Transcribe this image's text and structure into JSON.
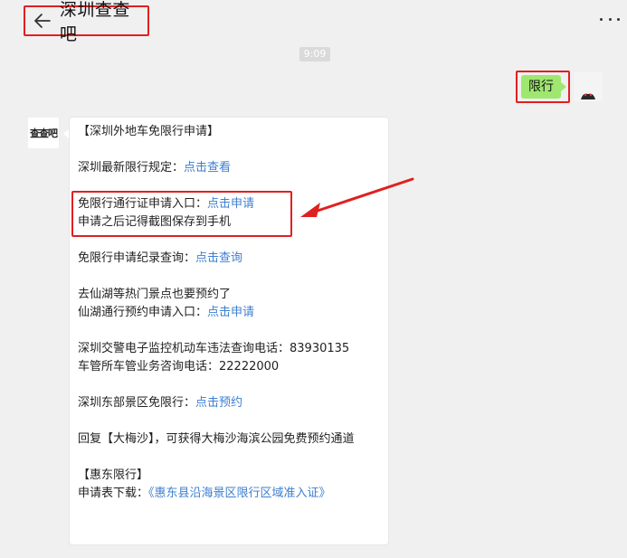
{
  "header": {
    "title": "深圳查查吧"
  },
  "timestamp": "9:09",
  "sent_message": {
    "text": "限行"
  },
  "bot": {
    "avatar_text": "查查吧"
  },
  "received_message": {
    "lines": [
      {
        "text": "【深圳外地车免限行申请】",
        "link": ""
      },
      {
        "text": "深圳最新限行规定：",
        "link": "点击查看"
      },
      {
        "text": "免限行通行证申请入口：",
        "link": "点击申请"
      },
      {
        "text": "申请之后记得截图保存到手机",
        "link": ""
      },
      {
        "text": "免限行申请纪录查询：",
        "link": "点击查询"
      },
      {
        "text": "去仙湖等热门景点也要预约了",
        "link": ""
      },
      {
        "text": "仙湖通行预约申请入口：",
        "link": "点击申请"
      },
      {
        "text": "深圳交警电子监控机动车违法查询电话：83930135",
        "link": ""
      },
      {
        "text": "车管所车管业务咨询电话：22222000",
        "link": ""
      },
      {
        "text": "深圳东部景区免限行：",
        "link": "点击预约"
      },
      {
        "text": "回复【大梅沙】，可获得大梅沙海滨公园免费预约通道",
        "link": ""
      },
      {
        "text": "【惠东限行】",
        "link": ""
      },
      {
        "text": "申请表下载：",
        "link": "《惠东县沿海景区限行区域准入证》"
      }
    ]
  },
  "colors": {
    "link": "#3c7fd0",
    "highlight": "#e02020",
    "sent_bubble": "#9fe870"
  }
}
